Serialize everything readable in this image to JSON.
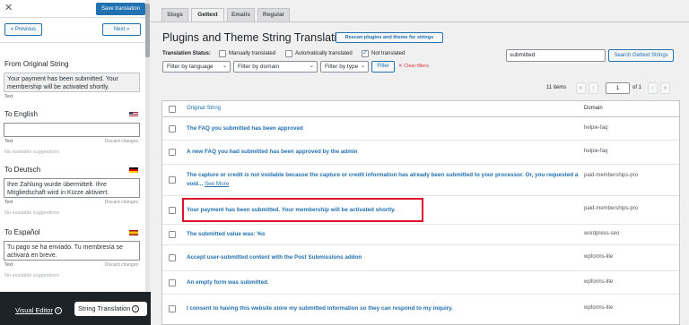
{
  "sidebar": {
    "save_label": "Save translation",
    "prev_label": "« Previous",
    "next_label": "Next »",
    "original": {
      "heading": "From Original String",
      "text": "Your payment has been submitted. Your membership will be activated shortly.",
      "meta": "Text"
    },
    "languages": [
      {
        "heading": "To English",
        "value": "",
        "meta_left": "Text",
        "meta_right": "Discard changes",
        "no_suggestions": "No available suggestions"
      },
      {
        "heading": "To Deutsch",
        "value": "Ihre Zahlung wurde übermittelt. Ihre Mitgliedschaft wird in Kürze aktiviert.",
        "meta_left": "Text",
        "meta_right": "Discard changes",
        "no_suggestions": "No available suggestions"
      },
      {
        "heading": "To Español",
        "value": "Tu pago se ha enviado. Tu membresía se activará en breve.",
        "meta_left": "Text",
        "meta_right": "Discard changes",
        "no_suggestions": "No available suggestions"
      }
    ],
    "visual_editor_label": "Visual Editor",
    "string_translation_label": "String Translation"
  },
  "main": {
    "tabs": [
      {
        "label": "Slugs",
        "active": false
      },
      {
        "label": "Gettext",
        "active": true
      },
      {
        "label": "Emails",
        "active": false
      },
      {
        "label": "Regular",
        "active": false
      }
    ],
    "title": "Plugins and Theme String Translation",
    "rescan_label": "Rescan plugins and theme for strings",
    "status": {
      "label": "Translation Status:",
      "manually": "Manually translated",
      "automatically": "Automatically translated",
      "not_translated": "Not translated"
    },
    "filters": {
      "language": "Filter by language",
      "domain": "Filter by domain",
      "type": "Filter by type",
      "filter_label": "Filter",
      "clear_label": "✕ Clear filters"
    },
    "search": {
      "value": "submitted",
      "button_label": "Search Gettext Strings"
    },
    "pagination": {
      "items": "11 items",
      "first": "«",
      "prev": "‹",
      "page": "1",
      "of": "of 1",
      "next": "›",
      "last": "»"
    },
    "table": {
      "col_original": "Original String",
      "col_domain": "Domain",
      "rows": [
        {
          "text": "The FAQ you submitted has been approved",
          "domain": "helpie-faq"
        },
        {
          "text": "A new FAQ you had submitted has been approved by the admin",
          "domain": "helpie-faq"
        },
        {
          "text": "The capture or credit is not voidable because the capture or credit information has already been submitted to your processor. Or, you requested a void...",
          "see_more": "See More",
          "domain": "paid-memberships-pro"
        },
        {
          "text": "Your payment has been submitted. Your membership will be activated shortly.",
          "domain": "paid-memberships-pro"
        },
        {
          "text": "The submitted value was: %s",
          "domain": "wordpress-seo"
        },
        {
          "text": "Accept user-submitted content with the Post Submissions addon",
          "domain": "wpforms-lite"
        },
        {
          "text": "An empty form was submitted.",
          "domain": "wpforms-lite"
        },
        {
          "text": "I consent to having this website store my submitted information so they can respond to my inquiry.",
          "domain": "wpforms-lite"
        }
      ]
    }
  },
  "colors": {
    "accent": "#2271b1",
    "highlight": "#e0102a",
    "sidebar_bottom": "#1d2327"
  }
}
